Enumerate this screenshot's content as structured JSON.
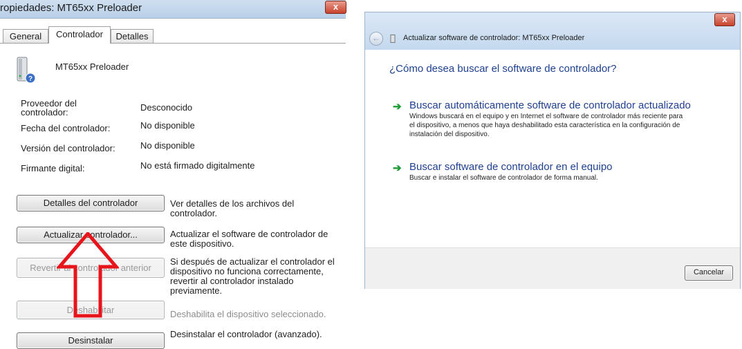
{
  "left_dialog": {
    "title": "ropiedades: MT65xx Preloader",
    "close_glyph": "x",
    "tabs": [
      "General",
      "Controlador",
      "Detalles"
    ],
    "device_name": "MT65xx Preloader",
    "properties": [
      {
        "label": "Proveedor del controlador:",
        "value": "Desconocido"
      },
      {
        "label": "Fecha del controlador:",
        "value": "No disponible"
      },
      {
        "label": "Versión del controlador:",
        "value": "No disponible"
      },
      {
        "label": "Firmante digital:",
        "value": "No está firmado digitalmente"
      }
    ],
    "buttons": [
      {
        "label": "Detalles del controlador",
        "description": "Ver detalles de los archivos del controlador.",
        "enabled": true
      },
      {
        "label": "Actualizar controlador...",
        "description": "Actualizar el software de controlador de este dispositivo.",
        "enabled": true
      },
      {
        "label": "Revertir al controlador anterior",
        "description": "Si después de actualizar el controlador el dispositivo no funciona correctamente, revertir al controlador instalado previamente.",
        "enabled": false
      },
      {
        "label": "Deshabilitar",
        "description": "Deshabilita el dispositivo seleccionado.",
        "enabled": false
      },
      {
        "label": "Desinstalar",
        "description": "Desinstalar el controlador (avanzado).",
        "enabled": true
      }
    ]
  },
  "annotation": {
    "arrow_color": "#e8141b",
    "icon": "red-up-arrow"
  },
  "wizard": {
    "title": "Actualizar software de controlador: MT65xx Preloader",
    "back_glyph": "←",
    "close_glyph": "x",
    "question": "¿Cómo desea buscar el software de controlador?",
    "options": [
      {
        "arrow": "➔",
        "title": "Buscar automáticamente software de controlador actualizado",
        "description": "Windows buscará en el equipo y en Internet el software de controlador más reciente para el dispositivo, a menos que haya deshabilitado esta característica en la configuración de instalación del dispositivo."
      },
      {
        "arrow": "➔",
        "title": "Buscar software de controlador en el equipo",
        "description": "Buscar e instalar el software de controlador de forma manual."
      }
    ],
    "cancel_label": "Cancelar"
  },
  "colors": {
    "link_blue": "#1f3f8f",
    "option_arrow_green": "#1e9b34",
    "close_red": "#c8432d"
  }
}
